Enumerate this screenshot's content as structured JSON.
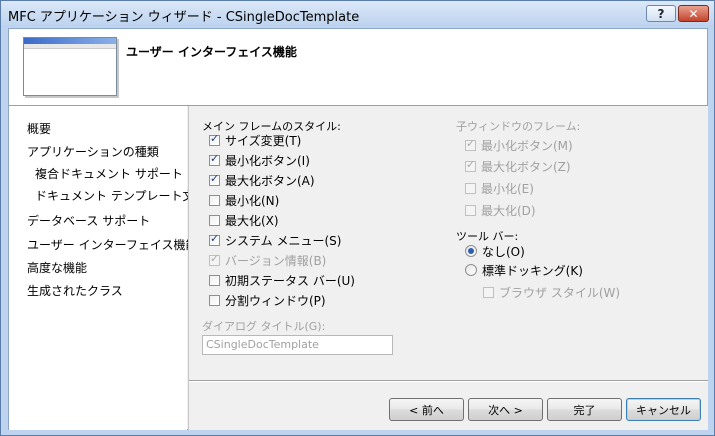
{
  "window": {
    "title": "MFC アプリケーション ウィザード - CSingleDocTemplate",
    "help_label": "?",
    "close_label": "✕"
  },
  "header": {
    "title": "ユーザー インターフェイス機能"
  },
  "nav": {
    "items": [
      {
        "label": "概要"
      },
      {
        "label": "アプリケーションの種類"
      },
      {
        "label": "複合ドキュメント サポート"
      },
      {
        "label": "ドキュメント テンプレート文字列"
      },
      {
        "label": "データベース サポート"
      },
      {
        "label": "ユーザー インターフェイス機能"
      },
      {
        "label": "高度な機能"
      },
      {
        "label": "生成されたクラス"
      }
    ]
  },
  "main_frame": {
    "label": "メイン フレームのスタイル:",
    "options": [
      {
        "label": "サイズ変更(T)",
        "checked": true,
        "enabled": true
      },
      {
        "label": "最小化ボタン(I)",
        "checked": true,
        "enabled": true
      },
      {
        "label": "最大化ボタン(A)",
        "checked": true,
        "enabled": true
      },
      {
        "label": "最小化(N)",
        "checked": false,
        "enabled": true
      },
      {
        "label": "最大化(X)",
        "checked": false,
        "enabled": true
      },
      {
        "label": "システム メニュー(S)",
        "checked": true,
        "enabled": true
      },
      {
        "label": "バージョン情報(B)",
        "checked": true,
        "enabled": false
      },
      {
        "label": "初期ステータス バー(U)",
        "checked": false,
        "enabled": true
      },
      {
        "label": "分割ウィンドウ(P)",
        "checked": false,
        "enabled": true
      }
    ]
  },
  "child_frame": {
    "label": "子ウィンドウのフレーム:",
    "options": [
      {
        "label": "最小化ボタン(M)",
        "checked": true
      },
      {
        "label": "最大化ボタン(Z)",
        "checked": true
      },
      {
        "label": "最小化(E)",
        "checked": false
      },
      {
        "label": "最大化(D)",
        "checked": false
      }
    ]
  },
  "toolbar": {
    "label": "ツール バー:",
    "options": [
      {
        "label": "なし(O)",
        "selected": true
      },
      {
        "label": "標準ドッキング(K)",
        "selected": false
      }
    ],
    "browser_style": {
      "label": "ブラウザ スタイル(W)",
      "checked": false
    }
  },
  "dialog_title": {
    "label": "ダイアログ タイトル(G):",
    "value": "CSingleDocTemplate"
  },
  "buttons": {
    "prev": "< 前へ",
    "next": "次へ >",
    "finish": "完了",
    "cancel": "キャンセル"
  },
  "colors": {
    "titlebar": "#bcd2ee",
    "close": "#c4432b",
    "radio_dot": "#2b5fb0"
  }
}
